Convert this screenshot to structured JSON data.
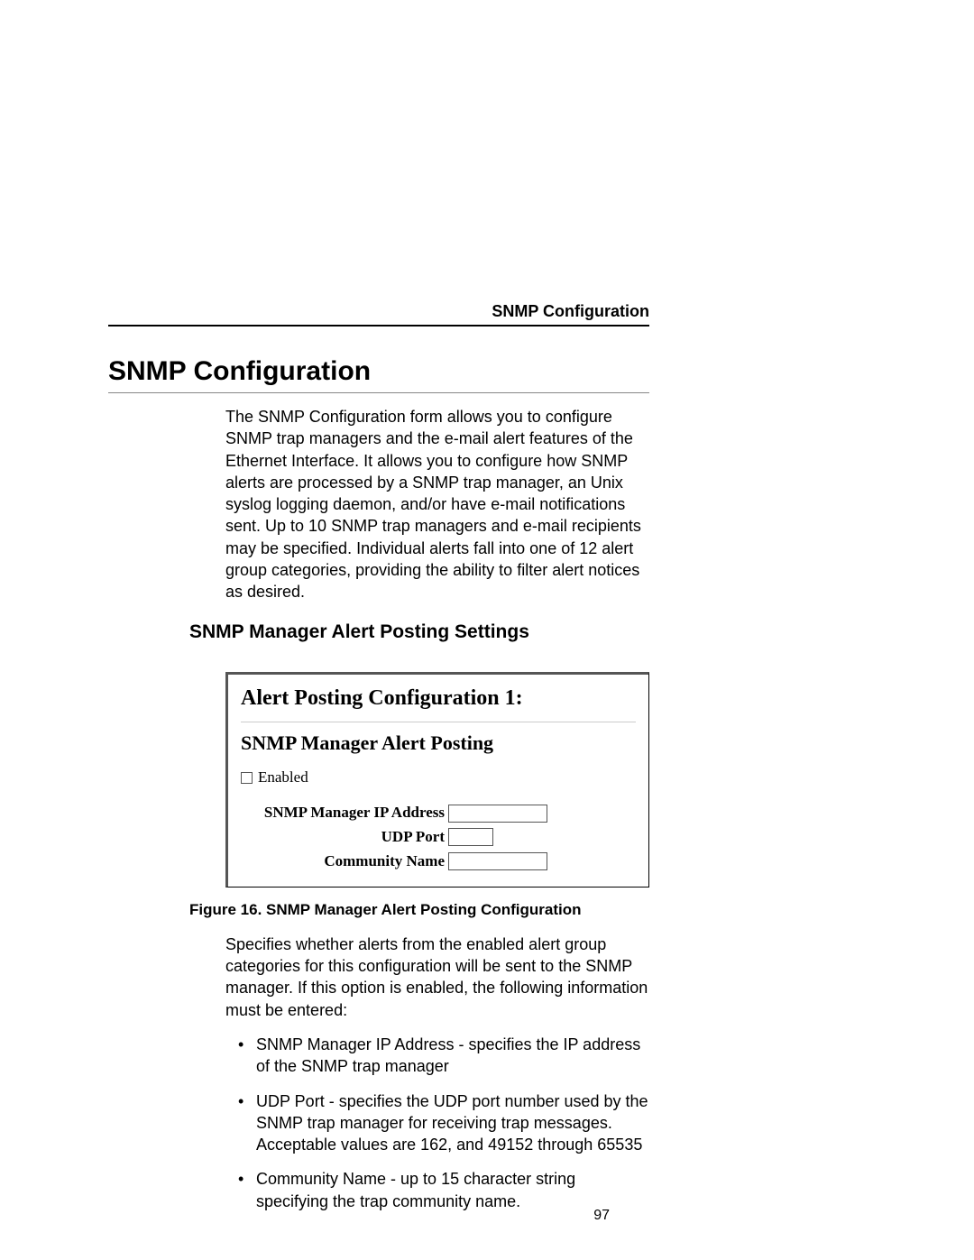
{
  "header": {
    "running": "SNMP Configuration"
  },
  "title": "SNMP Configuration",
  "intro": "The SNMP Configuration form allows you to configure SNMP trap managers and the e-mail alert features of the Ethernet Interface. It allows you to configure how SNMP alerts are processed by a SNMP trap manager, an Unix syslog logging daemon, and/or have e-mail notifications sent. Up to 10 SNMP trap managers and e-mail recipients may be specified. Individual alerts fall into one of 12 alert group categories, providing the ability to filter alert notices as desired.",
  "section_heading": "SNMP Manager Alert Posting Settings",
  "figure": {
    "title": "Alert Posting Configuration 1:",
    "subtitle": "SNMP Manager Alert Posting",
    "enabled_label": "Enabled",
    "enabled_checked": false,
    "fields": {
      "ip_label": "SNMP Manager IP Address",
      "ip_value": "",
      "port_label": "UDP Port",
      "port_value": "",
      "community_label": "Community Name",
      "community_value": ""
    },
    "caption": "Figure 16. SNMP Manager Alert Posting Configuration"
  },
  "after_figure": "Specifies whether alerts from the enabled alert group categories for this configuration will be sent to the SNMP manager. If this option is enabled, the following information must be entered:",
  "bullets": [
    "SNMP Manager IP Address - specifies the IP address of the SNMP trap manager",
    "UDP Port - specifies the UDP port number used by the SNMP trap manager for receiving trap messages. Acceptable values are 162, and 49152 through 65535",
    "Community Name - up to 15 character string specifying the trap community name."
  ],
  "page_number": "97"
}
